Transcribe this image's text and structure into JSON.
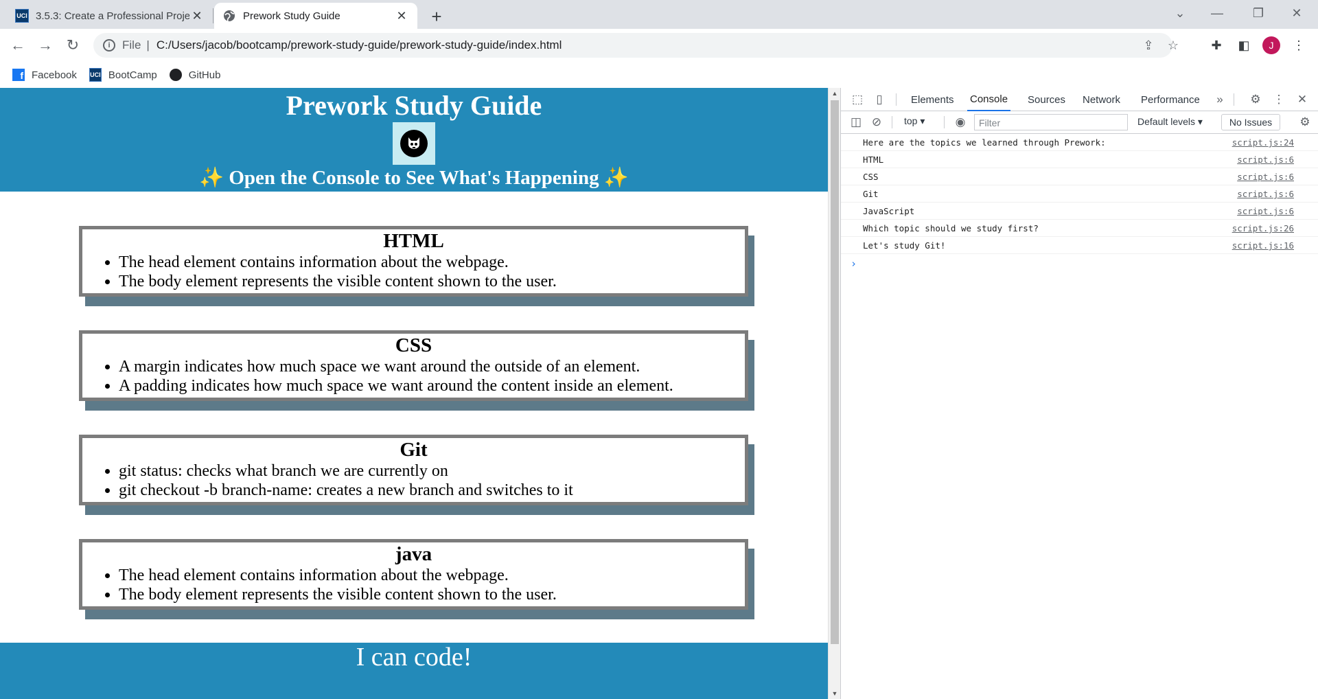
{
  "browser": {
    "tabs": [
      {
        "title": "3.5.3: Create a Professional Proje",
        "favicon": "uci-logo",
        "active": false
      },
      {
        "title": "Prework Study Guide",
        "favicon": "globe-icon",
        "active": true
      }
    ],
    "address": {
      "scheme": "File",
      "separator": "|",
      "url": "C:/Users/jacob/bootcamp/prework-study-guide/prework-study-guide/index.html"
    },
    "profile_initial": "J",
    "bookmarks": [
      {
        "label": "Facebook",
        "icon": "facebook-icon"
      },
      {
        "label": "BootCamp",
        "icon": "uci-logo"
      },
      {
        "label": "GitHub",
        "icon": "github-icon"
      }
    ]
  },
  "page": {
    "title": "Prework Study Guide",
    "subtitle": "✨ Open the Console to See What's Happening ✨",
    "logo_icon": "cat-skull-logo",
    "cards": [
      {
        "heading": "HTML",
        "items": [
          "The head element contains information about the webpage.",
          "The body element represents the visible content shown to the user."
        ]
      },
      {
        "heading": "CSS",
        "items": [
          "A margin indicates how much space we want around the outside of an element.",
          "A padding indicates how much space we want around the content inside an element."
        ]
      },
      {
        "heading": "Git",
        "items": [
          "git status: checks what branch we are currently on",
          "git checkout -b branch-name: creates a new branch and switches to it"
        ]
      },
      {
        "heading": "java",
        "items": [
          "The head element contains information about the webpage.",
          "The body element represents the visible content shown to the user."
        ]
      }
    ],
    "footer": "I can code!",
    "colors": {
      "header_bg": "#238ab9",
      "card_shadow": "#5d7a89",
      "card_border": "#7c7c7c"
    }
  },
  "devtools": {
    "tabs": [
      "Elements",
      "Console",
      "Sources",
      "Network",
      "Performance"
    ],
    "active_tab": "Console",
    "context": "top",
    "filter_placeholder": "Filter",
    "levels": "Default levels",
    "issues": "No Issues",
    "console": [
      {
        "message": "Here are the topics we learned through Prework:",
        "source": "script.js:24"
      },
      {
        "message": "HTML",
        "source": "script.js:6"
      },
      {
        "message": "CSS",
        "source": "script.js:6"
      },
      {
        "message": "Git",
        "source": "script.js:6"
      },
      {
        "message": "JavaScript",
        "source": "script.js:6"
      },
      {
        "message": "Which topic should we study first?",
        "source": "script.js:26"
      },
      {
        "message": "Let's study Git!",
        "source": "script.js:16"
      }
    ]
  }
}
